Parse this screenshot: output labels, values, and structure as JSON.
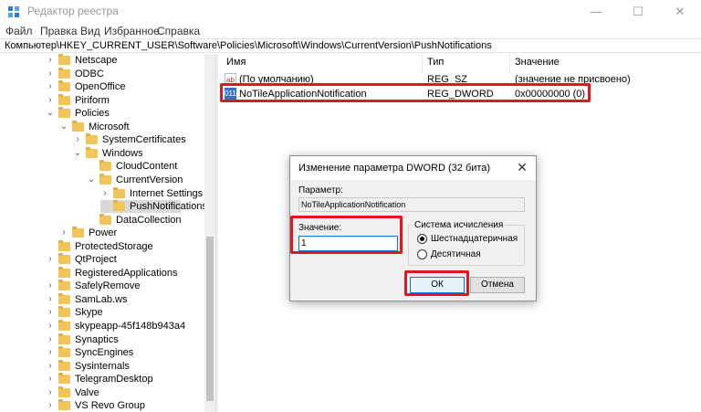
{
  "window": {
    "title": "Редактор реестра",
    "controls": [
      "—",
      "☐",
      "✕"
    ]
  },
  "menu": [
    "Файл",
    "Правка",
    "Вид",
    "Избранное",
    "Справка"
  ],
  "address": "Компьютер\\HKEY_CURRENT_USER\\Software\\Policies\\Microsoft\\Windows\\CurrentVersion\\PushNotifications",
  "tree": [
    {
      "label": "Netscape",
      "level": 3,
      "chevron": ">"
    },
    {
      "label": "ODBC",
      "level": 3,
      "chevron": ">"
    },
    {
      "label": "OpenOffice",
      "level": 3,
      "chevron": ">"
    },
    {
      "label": "Piriform",
      "level": 3,
      "chevron": ">"
    },
    {
      "label": "Policies",
      "level": 3,
      "chevron": "v"
    },
    {
      "label": "Microsoft",
      "level": 4,
      "chevron": "v"
    },
    {
      "label": "SystemCertificates",
      "level": 5,
      "chevron": ">"
    },
    {
      "label": "Windows",
      "level": 5,
      "chevron": "v"
    },
    {
      "label": "CloudContent",
      "level": 6,
      "chevron": ""
    },
    {
      "label": "CurrentVersion",
      "level": 6,
      "chevron": "v"
    },
    {
      "label": "Internet Settings",
      "level": 7,
      "chevron": ">"
    },
    {
      "label": "PushNotifications",
      "level": 7,
      "chevron": "",
      "selected": true
    },
    {
      "label": "DataCollection",
      "level": 6,
      "chevron": ""
    },
    {
      "label": "Power",
      "level": 4,
      "chevron": ">"
    },
    {
      "label": "ProtectedStorage",
      "level": 3,
      "chevron": ""
    },
    {
      "label": "QtProject",
      "level": 3,
      "chevron": ">"
    },
    {
      "label": "RegisteredApplications",
      "level": 3,
      "chevron": ""
    },
    {
      "label": "SafelyRemove",
      "level": 3,
      "chevron": ">"
    },
    {
      "label": "SamLab.ws",
      "level": 3,
      "chevron": ">"
    },
    {
      "label": "Skype",
      "level": 3,
      "chevron": ">"
    },
    {
      "label": "skypeapp-45f148b943a4",
      "level": 3,
      "chevron": ">"
    },
    {
      "label": "Synaptics",
      "level": 3,
      "chevron": ">"
    },
    {
      "label": "SyncEngines",
      "level": 3,
      "chevron": ">"
    },
    {
      "label": "Sysinternals",
      "level": 3,
      "chevron": ">"
    },
    {
      "label": "TelegramDesktop",
      "level": 3,
      "chevron": ">"
    },
    {
      "label": "Valve",
      "level": 3,
      "chevron": ">"
    },
    {
      "label": "VS Revo Group",
      "level": 3,
      "chevron": ">"
    }
  ],
  "list": {
    "columns": [
      "Имя",
      "Тип",
      "Значение"
    ],
    "rows": [
      {
        "icon": "string-value-icon",
        "icon_text": "ab",
        "name": "(По умолчанию)",
        "type": "REG_SZ",
        "value": "(значение не присвоено)"
      },
      {
        "icon": "dword-value-icon",
        "icon_text": "011",
        "name": "NoTileApplicationNotification",
        "type": "REG_DWORD",
        "value": "0x00000000 (0)"
      }
    ]
  },
  "dialog": {
    "title": "Изменение параметра DWORD (32 бита)",
    "param_label": "Параметр:",
    "param_value": "NoTileApplicationNotification",
    "value_label": "Значение:",
    "value": "1",
    "base_label": "Система исчисления",
    "base_options": [
      {
        "label": "Шестнадцатеричная",
        "selected": true
      },
      {
        "label": "Десятичная",
        "selected": false
      }
    ],
    "ok": "ОК",
    "cancel": "Отмена"
  },
  "colors": {
    "highlight": "#e3161f",
    "folder": "#f2c55a",
    "accent": "#0078d7"
  }
}
